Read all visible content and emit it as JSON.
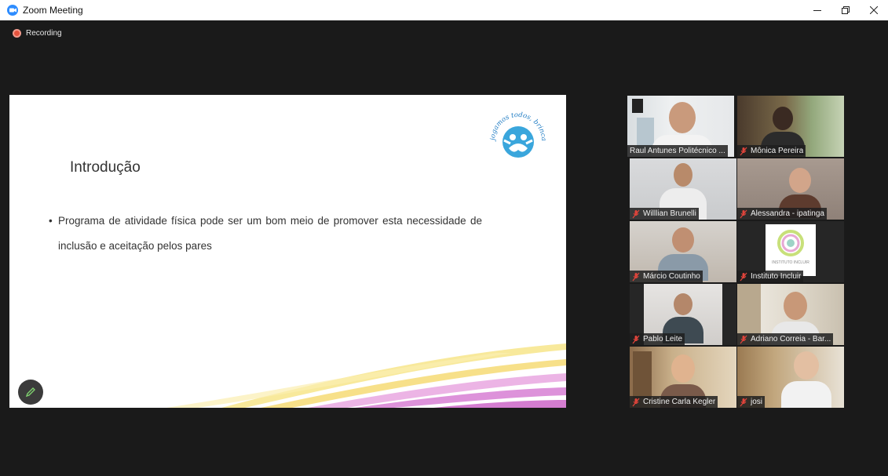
{
  "window": {
    "title": "Zoom Meeting"
  },
  "recording": {
    "label": "Recording"
  },
  "slide": {
    "title": "Introdução",
    "bullet": "Programa de atividade física pode ser um bom meio de promover esta necessidade de inclusão e aceitação pelos pares",
    "logo_text": "jogamos todos, brincamos todos"
  },
  "participants": [
    {
      "name": "Raul Antunes Politécnico ...",
      "muted": false,
      "active": true
    },
    {
      "name": "Mônica Pereira",
      "muted": true,
      "active": false
    },
    {
      "name": "Willlian Brunelli",
      "muted": true,
      "active": false
    },
    {
      "name": "Alessandra - ipatinga",
      "muted": true,
      "active": false
    },
    {
      "name": "Márcio Coutinho",
      "muted": true,
      "active": false
    },
    {
      "name": "Instituto Incluir",
      "muted": true,
      "active": false,
      "placeholder_text": "INSTITUTO INCLUIR"
    },
    {
      "name": "Pablo Leite",
      "muted": true,
      "active": false
    },
    {
      "name": "Adriano Correia - Bar...",
      "muted": true,
      "active": false
    },
    {
      "name": "Cristine Carla Kegler",
      "muted": true,
      "active": false
    },
    {
      "name": "josi",
      "muted": true,
      "active": false
    }
  ],
  "icons": {
    "app": "zoom-camera-icon",
    "minimize": "minimize-icon",
    "restore": "restore-icon",
    "close": "close-icon",
    "record": "record-icon",
    "pen": "pen-icon",
    "mute": "microphone-muted-icon"
  },
  "colors": {
    "zoom_blue": "#2d8cff",
    "active_speaker_border": "#a7d64a",
    "record_red": "#e5533d",
    "mute_red": "#e0443b"
  }
}
